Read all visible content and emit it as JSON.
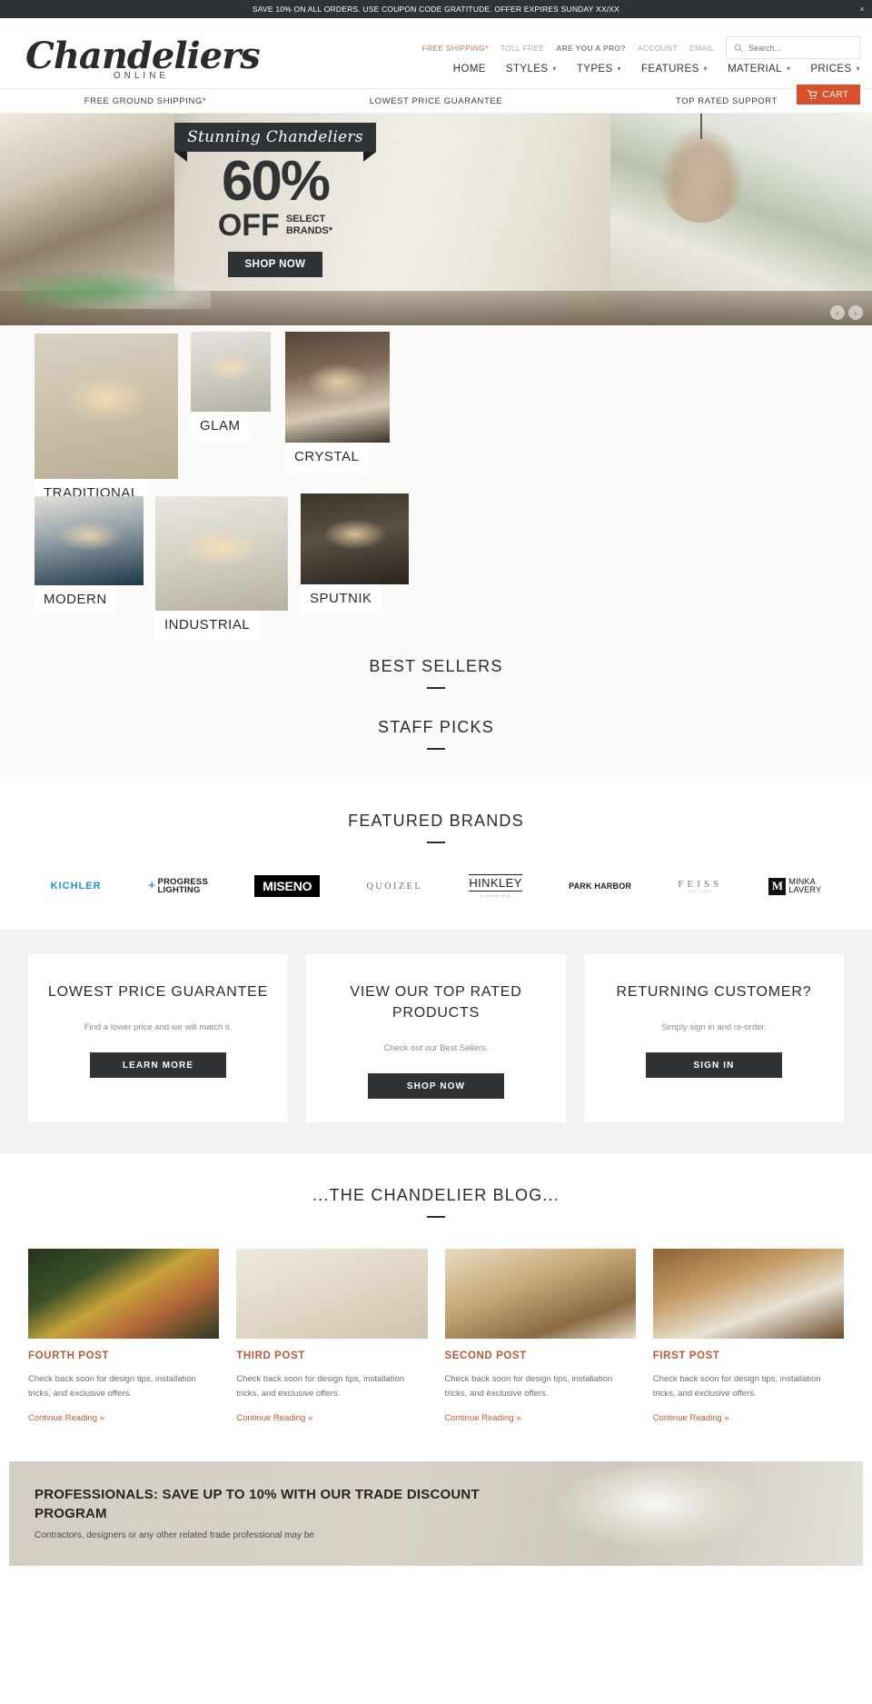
{
  "announcement": {
    "text": "SAVE 10% ON ALL ORDERS. USE COUPON CODE GRATITUDE. OFFER EXPIRES SUNDAY XX/XX",
    "close_label": "×"
  },
  "header": {
    "logo_main": "Chandeliers",
    "logo_sub": "ONLINE",
    "util_links": [
      {
        "label": "FREE SHIPPING*",
        "style": "accent"
      },
      {
        "label": "TOLL FREE",
        "style": "muted"
      },
      {
        "label": "ARE YOU A PRO?",
        "style": "dark"
      },
      {
        "label": "ACCOUNT",
        "style": "muted"
      },
      {
        "label": "EMAIL",
        "style": "muted"
      }
    ],
    "search": {
      "placeholder": "Search...",
      "value": "",
      "icon": "search-icon"
    },
    "nav": [
      {
        "label": "HOME",
        "caret": false
      },
      {
        "label": "STYLES",
        "caret": true
      },
      {
        "label": "TYPES",
        "caret": true
      },
      {
        "label": "FEATURES",
        "caret": true
      },
      {
        "label": "MATERIAL",
        "caret": true
      },
      {
        "label": "PRICES",
        "caret": true
      }
    ],
    "cart": {
      "label": "CART",
      "icon": "cart-icon",
      "color": "#d9512c"
    }
  },
  "benefits": [
    "FREE GROUND SHIPPING*",
    "LOWEST PRICE GUARANTEE",
    "TOP RATED SUPPORT"
  ],
  "hero": {
    "ribbon": "Stunning Chandeliers",
    "percent": "60%",
    "off": "OFF",
    "select_line1": "SELECT",
    "select_line2": "BRANDS*",
    "cta": "SHOP NOW",
    "prev_arrow": "‹",
    "next_arrow": "›"
  },
  "categories": [
    {
      "label": "TRADITIONAL"
    },
    {
      "label": "GLAM"
    },
    {
      "label": "CRYSTAL"
    },
    {
      "label": "MODERN"
    },
    {
      "label": "INDUSTRIAL"
    },
    {
      "label": "SPUTNIK"
    }
  ],
  "sections": {
    "best_sellers": "BEST SELLERS",
    "staff_picks": "STAFF PICKS",
    "featured_brands": "FEATURED BRANDS",
    "blog": "...THE CHANDELIER BLOG..."
  },
  "brands": [
    {
      "name": "KICHLER"
    },
    {
      "name": "PROGRESS",
      "name2": "LIGHTING"
    },
    {
      "name": "MISENO"
    },
    {
      "name": "QUOIZEL"
    },
    {
      "name": "HINKLEY",
      "sub": "LIGHTING"
    },
    {
      "name": "PARK HARBOR"
    },
    {
      "name": "FEISS",
      "sub": "EST. 1955"
    },
    {
      "name": "MINKA",
      "name2": "LAVERY",
      "mark": "M"
    }
  ],
  "promos": [
    {
      "title": "LOWEST PRICE GUARANTEE",
      "sub": "Find a lower price and we will match it.",
      "button": "LEARN MORE"
    },
    {
      "title": "VIEW OUR TOP RATED PRODUCTS",
      "sub": "Check out our Best Sellers.",
      "button": "SHOP NOW"
    },
    {
      "title": "RETURNING CUSTOMER?",
      "sub": "Simply sign in and re-order.",
      "button": "SIGN IN"
    }
  ],
  "posts": [
    {
      "title": "FOURTH POST",
      "body": "Check back soon for design tips, installation tricks, and exclusive offers.",
      "more": "Continue Reading »"
    },
    {
      "title": "THIRD POST",
      "body": "Check back soon for design tips, installation tricks, and exclusive offers.",
      "more": "Continue Reading »"
    },
    {
      "title": "SECOND POST",
      "body": "Check back soon for design tips, installation tricks, and exclusive offers.",
      "more": "Continue Reading »"
    },
    {
      "title": "FIRST POST",
      "body": "Check back soon for design tips, installation tricks, and exclusive offers.",
      "more": "Continue Reading »"
    }
  ],
  "trade": {
    "title": "PROFESSIONALS: SAVE UP TO 10% WITH OUR TRADE DISCOUNT PROGRAM",
    "sub": "Contractors, designers or any other related trade professional may be"
  }
}
